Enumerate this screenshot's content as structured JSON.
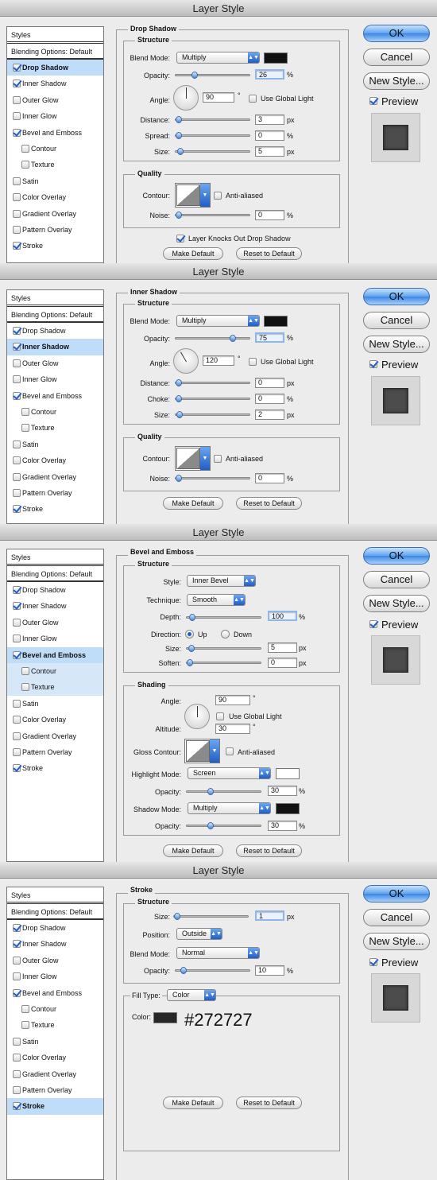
{
  "dialog_title": "Layer Style",
  "buttons": {
    "ok": "OK",
    "cancel": "Cancel",
    "new_style": "New Style...",
    "preview": "Preview",
    "make_default": "Make Default",
    "reset_default": "Reset to Default"
  },
  "style_list": {
    "header": "Styles",
    "blending": "Blending Options: Default",
    "items": [
      "Drop Shadow",
      "Inner Shadow",
      "Outer Glow",
      "Inner Glow",
      "Bevel and Emboss",
      "Contour",
      "Texture",
      "Satin",
      "Color Overlay",
      "Gradient Overlay",
      "Pattern Overlay",
      "Stroke"
    ],
    "checked": [
      "Drop Shadow",
      "Inner Shadow",
      "Bevel and Emboss",
      "Stroke"
    ]
  },
  "common": {
    "structure": "Structure",
    "quality": "Quality",
    "blend_mode": "Blend Mode:",
    "opacity": "Opacity:",
    "angle": "Angle:",
    "use_global_light": "Use Global Light",
    "distance": "Distance:",
    "size": "Size:",
    "contour": "Contour:",
    "anti_aliased": "Anti-aliased",
    "noise": "Noise:",
    "px": "px",
    "pct": "%",
    "deg": "°"
  },
  "drop_shadow": {
    "title": "Drop Shadow",
    "blend_mode": "Multiply",
    "color": "#111111",
    "opacity": "26",
    "angle": "90",
    "distance": "3",
    "spread_label": "Spread:",
    "spread": "0",
    "size": "5",
    "noise": "0",
    "knockout": "Layer Knocks Out Drop Shadow"
  },
  "inner_shadow": {
    "title": "Inner Shadow",
    "blend_mode": "Multiply",
    "color": "#111111",
    "opacity": "75",
    "angle": "120",
    "distance": "0",
    "choke_label": "Choke:",
    "choke": "0",
    "size": "2",
    "noise": "0"
  },
  "bevel_emboss": {
    "title": "Bevel and Emboss",
    "style_label": "Style:",
    "style": "Inner Bevel",
    "technique_label": "Technique:",
    "technique": "Smooth",
    "depth_label": "Depth:",
    "depth": "100",
    "direction_label": "Direction:",
    "up": "Up",
    "down": "Down",
    "size": "5",
    "soften_label": "Soften:",
    "soften": "0",
    "shading": "Shading",
    "angle": "90",
    "altitude_label": "Altitude:",
    "altitude": "30",
    "gloss_contour": "Gloss Contour:",
    "highlight_mode_label": "Highlight Mode:",
    "highlight_mode": "Screen",
    "highlight_color": "#ffffff",
    "highlight_opacity": "30",
    "shadow_mode_label": "Shadow Mode:",
    "shadow_mode": "Multiply",
    "shadow_color": "#111111",
    "shadow_opacity": "30"
  },
  "stroke": {
    "title": "Stroke",
    "size": "1",
    "position_label": "Position:",
    "position": "Outside",
    "blend_mode": "Normal",
    "opacity": "10",
    "fill_type_label": "Fill Type:",
    "fill_type": "Color",
    "color_label": "Color:",
    "color": "#272727",
    "color_text": "#272727"
  }
}
